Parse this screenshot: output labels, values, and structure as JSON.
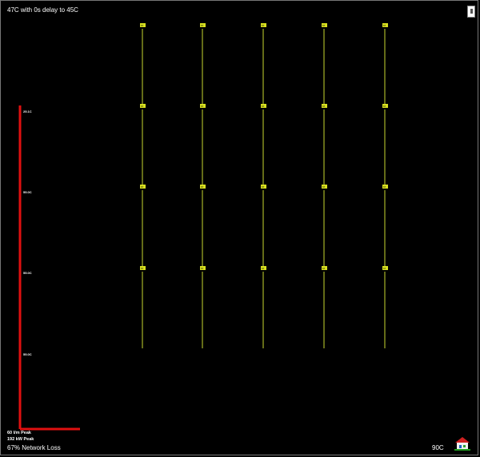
{
  "title": "47C with 0s delay to 45C",
  "branches": [
    {
      "temp_label": "25.1C",
      "nodes": [
        "67",
        "67",
        "67",
        "67",
        "67"
      ]
    },
    {
      "temp_label": "55.0C",
      "nodes": [
        "67",
        "67",
        "67",
        "67",
        "67"
      ]
    },
    {
      "temp_label": "55.0C",
      "nodes": [
        "67",
        "67",
        "67",
        "67",
        "67"
      ]
    },
    {
      "temp_label": "55.0C",
      "nodes": [
        "67",
        "67",
        "67",
        "67",
        "67"
      ]
    }
  ],
  "stats": {
    "flow": "60 l/m  Peak",
    "power": "192 kW  Peak",
    "network_loss": "67% Network Loss",
    "supply_temp": "90C"
  },
  "colors": {
    "riser_red": "#e01010",
    "branch_orange": "#e8a030",
    "drop_green": "#c8d830",
    "node_fill": "#d8e020"
  },
  "icons": {
    "corner": "sidebar-toggle-icon",
    "house": "house-icon"
  }
}
